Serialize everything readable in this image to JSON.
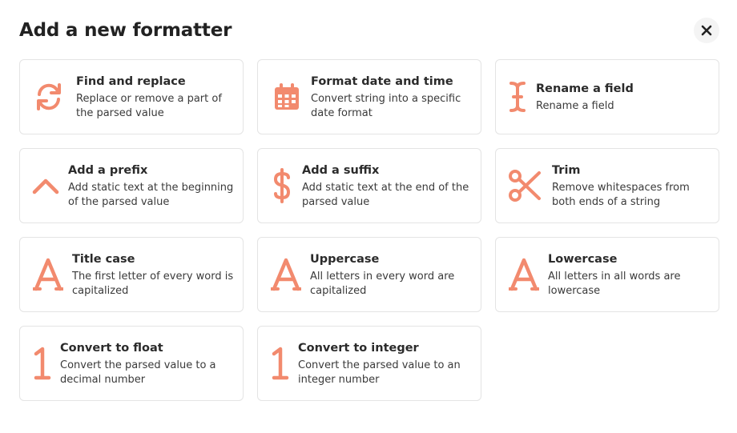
{
  "header": {
    "title": "Add a new formatter"
  },
  "icons": {
    "close": "close-icon",
    "accent": "#f28a6e"
  },
  "cards": [
    {
      "title": "Find and replace",
      "description": "Replace or remove a part of the parsed value",
      "icon": "refresh-icon"
    },
    {
      "title": "Format date and time",
      "description": "Convert string into a specific date format",
      "icon": "calendar-icon"
    },
    {
      "title": "Rename a field",
      "description": "Rename a field",
      "icon": "text-cursor-icon"
    },
    {
      "title": "Add a prefix",
      "description": "Add static text at the beginning of the parsed value",
      "icon": "chevron-up-icon"
    },
    {
      "title": "Add a suffix",
      "description": "Add static text at the end of the parsed value",
      "icon": "dollar-icon"
    },
    {
      "title": "Trim",
      "description": "Remove whitespaces from both ends of a string",
      "icon": "scissors-icon"
    },
    {
      "title": "Title case",
      "description": "The first letter of every word is capitalized",
      "icon": "letter-a-icon"
    },
    {
      "title": "Uppercase",
      "description": "All letters in every word are capitalized",
      "icon": "letter-a-icon"
    },
    {
      "title": "Lowercase",
      "description": "All letters in all words are lowercase",
      "icon": "letter-a-icon"
    },
    {
      "title": "Convert to float",
      "description": "Convert the parsed value to a decimal number",
      "icon": "number-one-icon"
    },
    {
      "title": "Convert to integer",
      "description": "Convert the parsed value to an integer number",
      "icon": "number-one-icon"
    }
  ]
}
